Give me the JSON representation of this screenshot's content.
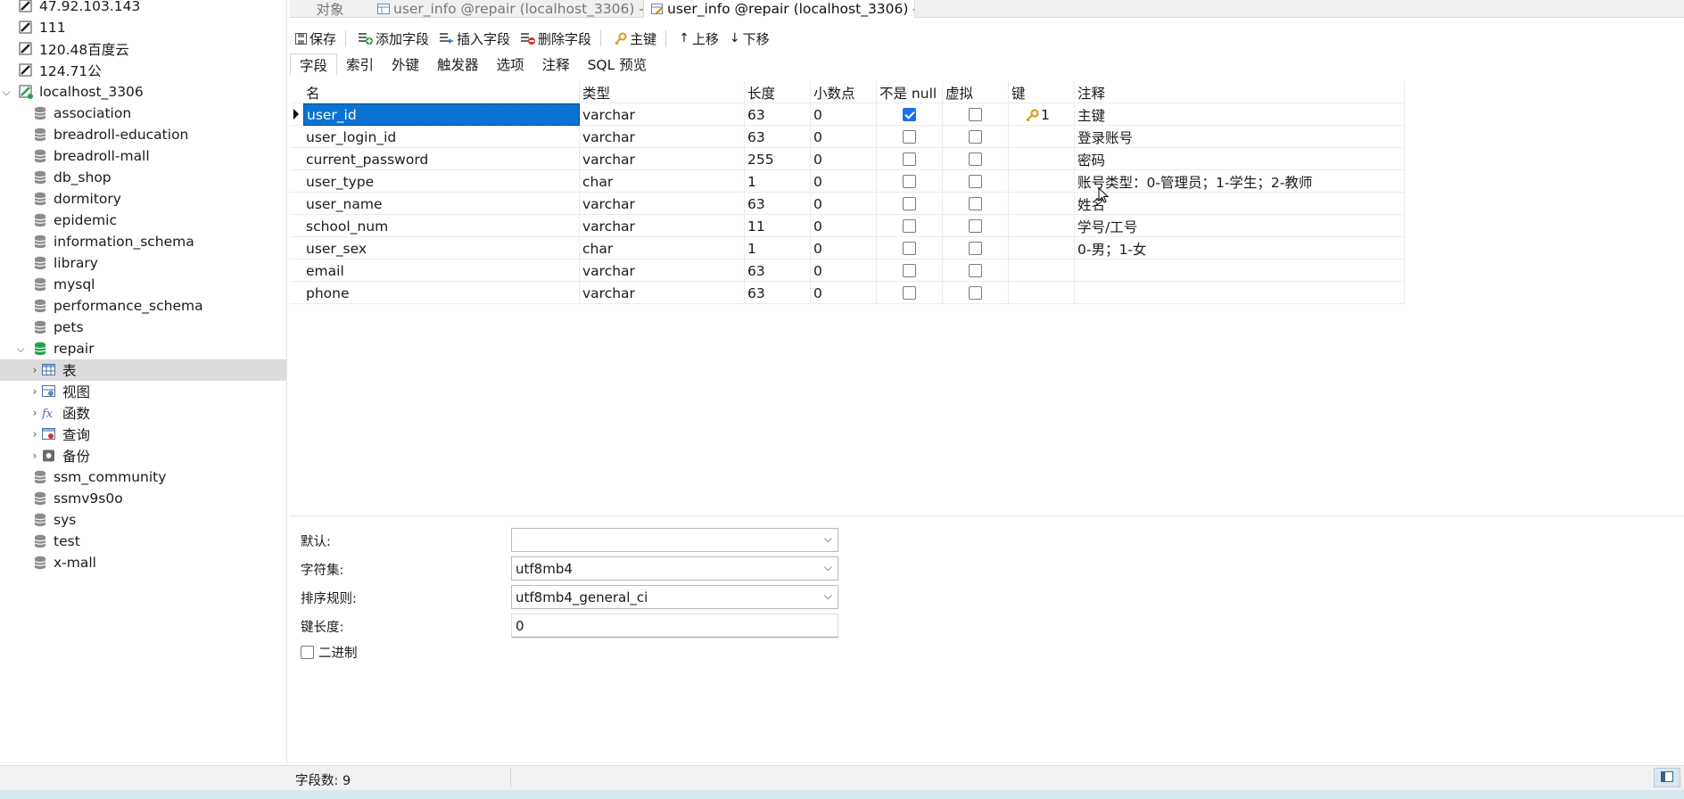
{
  "sidebar": {
    "items": [
      {
        "label": "47.92.103.143",
        "type": "connection"
      },
      {
        "label": "111",
        "type": "connection"
      },
      {
        "label": "120.48百度云",
        "type": "connection"
      },
      {
        "label": "124.71公",
        "type": "connection"
      },
      {
        "label": "localhost_3306",
        "type": "connection-open"
      },
      {
        "label": "association",
        "type": "database"
      },
      {
        "label": "breadroll-education",
        "type": "database"
      },
      {
        "label": "breadroll-mall",
        "type": "database"
      },
      {
        "label": "db_shop",
        "type": "database"
      },
      {
        "label": "dormitory",
        "type": "database"
      },
      {
        "label": "epidemic",
        "type": "database"
      },
      {
        "label": "information_schema",
        "type": "database"
      },
      {
        "label": "library",
        "type": "database"
      },
      {
        "label": "mysql",
        "type": "database"
      },
      {
        "label": "performance_schema",
        "type": "database"
      },
      {
        "label": "pets",
        "type": "database"
      },
      {
        "label": "repair",
        "type": "database-open"
      },
      {
        "label": "表",
        "type": "tables"
      },
      {
        "label": "视图",
        "type": "views"
      },
      {
        "label": "函数",
        "type": "functions"
      },
      {
        "label": "查询",
        "type": "queries"
      },
      {
        "label": "备份",
        "type": "backups"
      },
      {
        "label": "ssm_community",
        "type": "database"
      },
      {
        "label": "ssmv9s0o",
        "type": "database"
      },
      {
        "label": "sys",
        "type": "database"
      },
      {
        "label": "test",
        "type": "database"
      },
      {
        "label": "x-mall",
        "type": "database"
      }
    ]
  },
  "tabs": [
    {
      "label": "对象"
    },
    {
      "label": "user_info @repair (localhost_3306) - ..."
    },
    {
      "label": "user_info @repair (localhost_3306) - ..."
    }
  ],
  "toolbar": {
    "save": "保存",
    "add_field": "添加字段",
    "insert_field": "插入字段",
    "delete_field": "删除字段",
    "primary_key": "主键",
    "move_up": "上移",
    "move_down": "下移"
  },
  "subtabs": [
    "字段",
    "索引",
    "外键",
    "触发器",
    "选项",
    "注释",
    "SQL 预览"
  ],
  "grid": {
    "headers": {
      "name": "名",
      "type": "类型",
      "length": "长度",
      "decimals": "小数点",
      "not_null": "不是 null",
      "virtual": "虚拟",
      "key": "键",
      "comment": "注释"
    },
    "rows": [
      {
        "name": "user_id",
        "type": "varchar",
        "length": "63",
        "decimals": "0",
        "not_null": true,
        "virtual": false,
        "key": "1",
        "comment": "主键"
      },
      {
        "name": "user_login_id",
        "type": "varchar",
        "length": "63",
        "decimals": "0",
        "not_null": false,
        "virtual": false,
        "key": "",
        "comment": "登录账号"
      },
      {
        "name": "current_password",
        "type": "varchar",
        "length": "255",
        "decimals": "0",
        "not_null": false,
        "virtual": false,
        "key": "",
        "comment": "密码"
      },
      {
        "name": "user_type",
        "type": "char",
        "length": "1",
        "decimals": "0",
        "not_null": false,
        "virtual": false,
        "key": "",
        "comment": "账号类型：0-管理员；1-学生；2-教师"
      },
      {
        "name": "user_name",
        "type": "varchar",
        "length": "63",
        "decimals": "0",
        "not_null": false,
        "virtual": false,
        "key": "",
        "comment": "姓名"
      },
      {
        "name": "school_num",
        "type": "varchar",
        "length": "11",
        "decimals": "0",
        "not_null": false,
        "virtual": false,
        "key": "",
        "comment": "学号/工号"
      },
      {
        "name": "user_sex",
        "type": "char",
        "length": "1",
        "decimals": "0",
        "not_null": false,
        "virtual": false,
        "key": "",
        "comment": "0-男；1-女"
      },
      {
        "name": "email",
        "type": "varchar",
        "length": "63",
        "decimals": "0",
        "not_null": false,
        "virtual": false,
        "key": "",
        "comment": ""
      },
      {
        "name": "phone",
        "type": "varchar",
        "length": "63",
        "decimals": "0",
        "not_null": false,
        "virtual": false,
        "key": "",
        "comment": ""
      }
    ]
  },
  "properties": {
    "default_label": "默认:",
    "default_value": "",
    "charset_label": "字符集:",
    "charset_value": "utf8mb4",
    "collation_label": "排序规则:",
    "collation_value": "utf8mb4_general_ci",
    "key_length_label": "键长度:",
    "key_length_value": "0",
    "binary_label": "二进制"
  },
  "status": {
    "field_count": "字段数: 9"
  },
  "colors": {
    "selection": "#0a73d1",
    "db_green": "#22a34a",
    "key_gold": "#d4a017"
  }
}
